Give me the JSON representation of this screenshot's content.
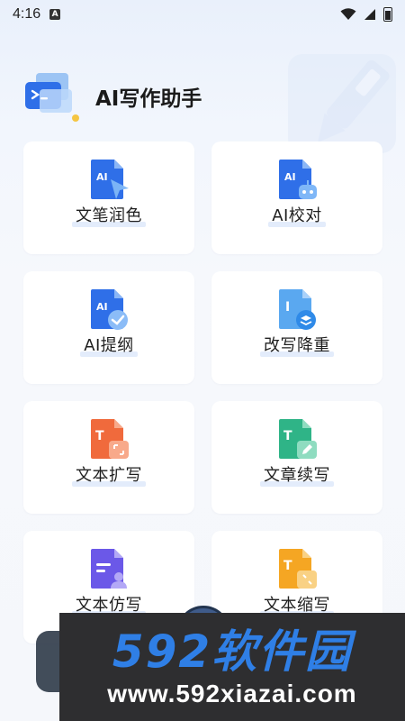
{
  "status_bar": {
    "time": "4:16",
    "app_badge": "A"
  },
  "app": {
    "title": "AI写作助手"
  },
  "cards": [
    {
      "label": "文笔润色",
      "icon": "document-ai-cursor-icon"
    },
    {
      "label": "AI校对",
      "icon": "document-ai-robot-icon"
    },
    {
      "label": "AI提纲",
      "icon": "document-ai-check-icon"
    },
    {
      "label": "改写降重",
      "icon": "document-layers-icon"
    },
    {
      "label": "文本扩写",
      "icon": "text-expand-icon"
    },
    {
      "label": "文章续写",
      "icon": "text-continue-pen-icon"
    },
    {
      "label": "文本仿写",
      "icon": "text-imitate-user-icon"
    },
    {
      "label": "文本缩写",
      "icon": "text-shrink-icon"
    }
  ],
  "watermark": {
    "main": "592软件园",
    "sub": "www.592xiazai.com"
  },
  "colors": {
    "blue": "#2f6fe8",
    "blue_light": "#6fb2f8",
    "orange": "#f06a3c",
    "green": "#2fb487",
    "purple": "#6b58e8",
    "amber": "#f5a623"
  }
}
